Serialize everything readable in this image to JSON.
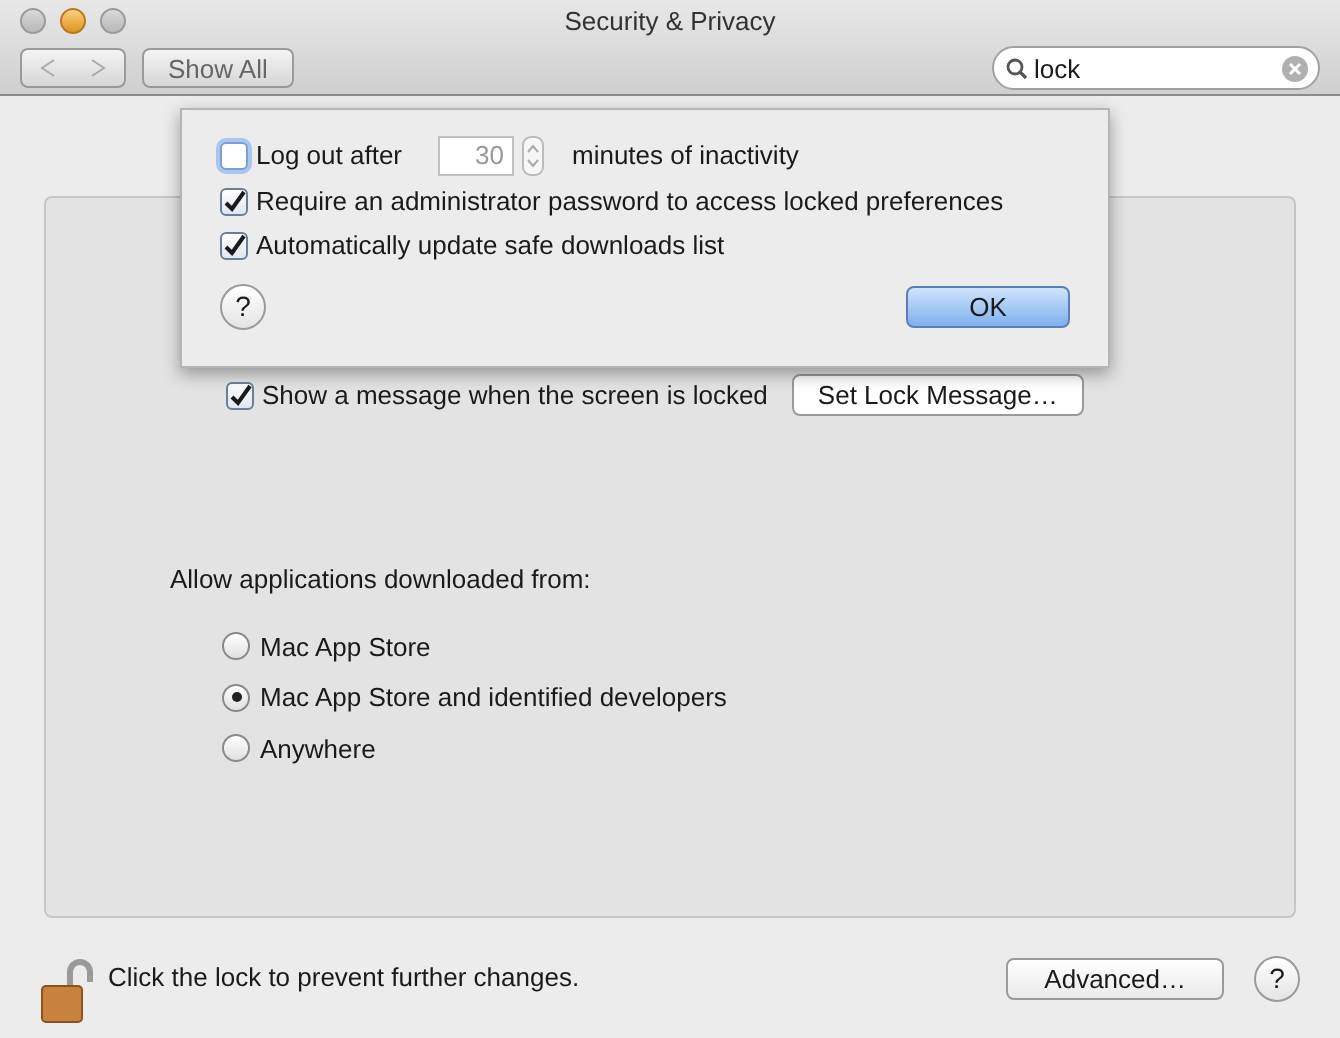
{
  "window": {
    "title": "Security & Privacy"
  },
  "toolbar": {
    "show_all": "Show All",
    "search": {
      "value": "lock"
    }
  },
  "sheet": {
    "options": [
      {
        "kind": "logout",
        "label": "Log out after",
        "checked": false,
        "minutes": "30",
        "suffix": "minutes of inactivity"
      },
      {
        "kind": "checkbox",
        "label": "Require an administrator password to access locked preferences",
        "checked": true
      },
      {
        "kind": "checkbox",
        "label": "Automatically update safe downloads list",
        "checked": true
      }
    ],
    "ok": "OK",
    "help": "?"
  },
  "lock_message": {
    "label": "Show a message when the screen is locked",
    "checked": true,
    "button": "Set Lock Message…"
  },
  "downloads": {
    "heading": "Allow applications downloaded from:",
    "options": [
      {
        "label": "Mac App Store",
        "selected": false
      },
      {
        "label": "Mac App Store and identified developers",
        "selected": true
      },
      {
        "label": "Anywhere",
        "selected": false
      }
    ]
  },
  "footer": {
    "lock_text": "Click the lock to prevent further changes.",
    "advanced": "Advanced…",
    "help": "?"
  }
}
